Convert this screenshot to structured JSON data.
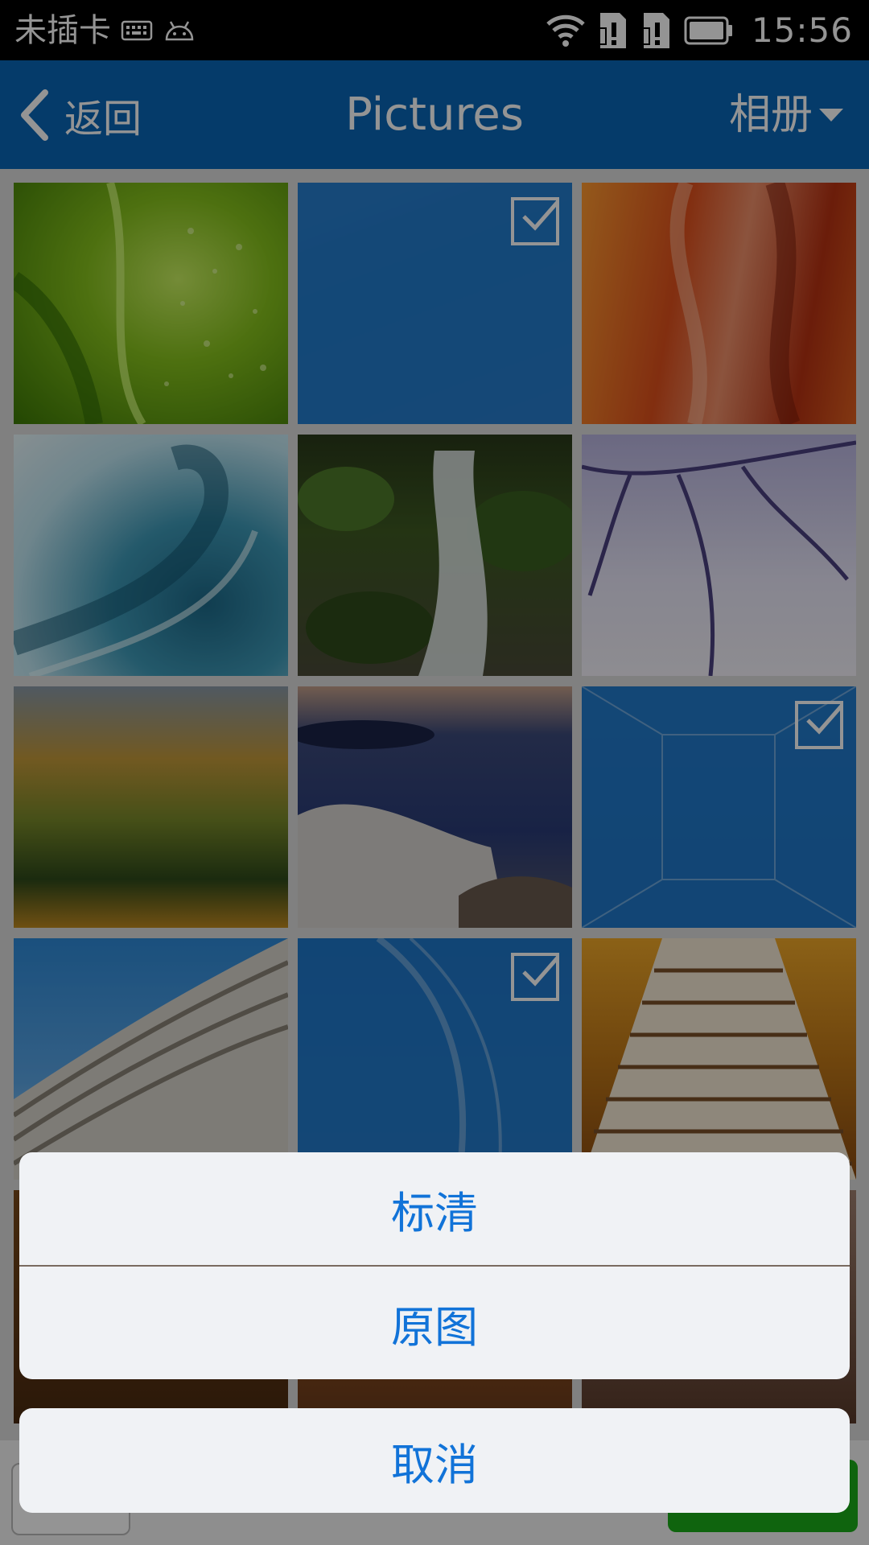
{
  "status_bar": {
    "carrier": "未插卡",
    "time": "15:56",
    "icons": [
      "keyboard-icon",
      "android-icon",
      "wifi-icon",
      "sim-1-alert-icon",
      "sim-2-alert-icon",
      "battery-icon"
    ]
  },
  "header": {
    "back_label": "返回",
    "title": "Pictures",
    "album_label": "相册"
  },
  "grid": {
    "photos": [
      {
        "subject": "green-leaf",
        "selected": false
      },
      {
        "subject": "snow-dunes",
        "selected": true
      },
      {
        "subject": "red-canyon",
        "selected": false
      },
      {
        "subject": "ocean-wave",
        "selected": false
      },
      {
        "subject": "waterfall",
        "selected": false
      },
      {
        "subject": "winter-branches",
        "selected": false
      },
      {
        "subject": "autumn-forest",
        "selected": false
      },
      {
        "subject": "lake-driftwood",
        "selected": false
      },
      {
        "subject": "glass-corridor",
        "selected": true
      },
      {
        "subject": "curved-building",
        "selected": false
      },
      {
        "subject": "glass-arch",
        "selected": true
      },
      {
        "subject": "escalator",
        "selected": false
      }
    ]
  },
  "action_sheet": {
    "options": [
      {
        "label": "标清"
      },
      {
        "label": "原图"
      }
    ],
    "cancel_label": "取消"
  },
  "colors": {
    "header_bg": "#0a66b7",
    "action_text": "#1173d8",
    "send_button": "#1aad19",
    "selected_tint": "#0d6ec8"
  }
}
